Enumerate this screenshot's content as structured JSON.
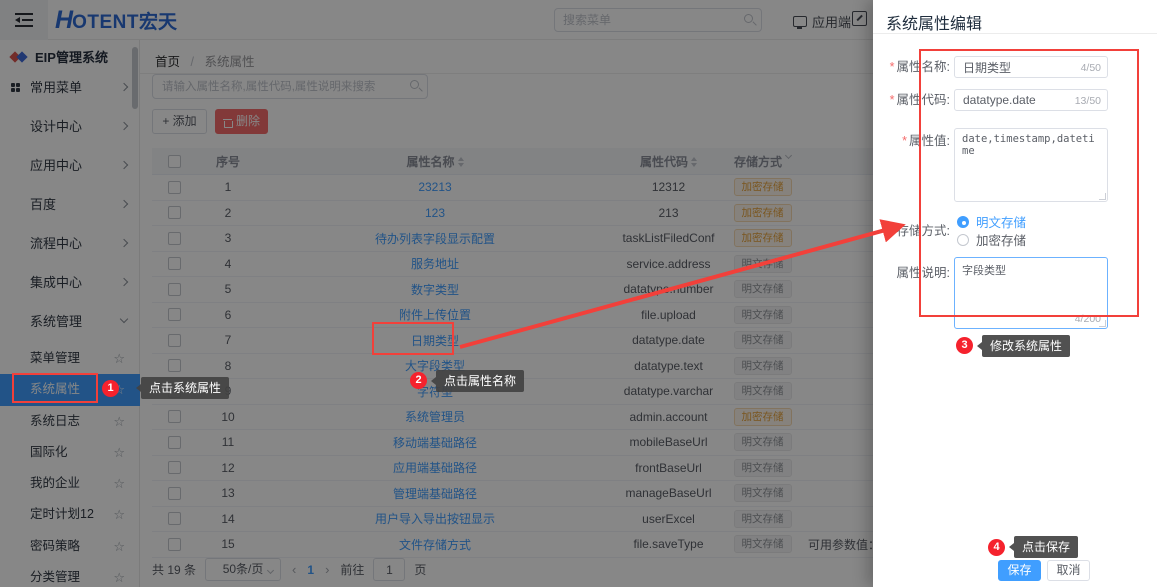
{
  "topbar": {
    "logo_h": "H",
    "logo_rest": "OTENT",
    "logo_cn": "宏天",
    "search_placeholder": "搜索菜单",
    "app_entry": "应用端"
  },
  "sidebar": {
    "title": "EIP管理系统",
    "menu": [
      {
        "label": "常用菜单",
        "chevron": "right",
        "icon": "grid"
      },
      {
        "label": "设计中心",
        "chevron": "right"
      },
      {
        "label": "应用中心",
        "chevron": "right"
      },
      {
        "label": "百度",
        "chevron": "right"
      },
      {
        "label": "流程中心",
        "chevron": "right"
      },
      {
        "label": "集成中心",
        "chevron": "right"
      },
      {
        "label": "系统管理",
        "chevron": "down"
      }
    ],
    "submenu": [
      {
        "label": "菜单管理"
      },
      {
        "label": "系统属性",
        "selected": true
      },
      {
        "label": "系统日志"
      },
      {
        "label": "国际化"
      },
      {
        "label": "我的企业"
      },
      {
        "label": "定时计划12"
      },
      {
        "label": "密码策略"
      },
      {
        "label": "分类管理"
      }
    ],
    "star": "☆"
  },
  "breadcrumb": {
    "home": "首页",
    "separator": "/",
    "current": "系统属性"
  },
  "toolbar": {
    "search_placeholder": "请输入属性名称,属性代码,属性说明来搜索",
    "add_label": "+ 添加",
    "delete_label": "删除"
  },
  "table": {
    "headers": {
      "index": "序号",
      "name": "属性名称",
      "code": "属性代码",
      "storage": "存储方式"
    },
    "storage_labels": {
      "enc": "加密存储",
      "plain": "明文存储"
    },
    "rows": [
      {
        "n": "1",
        "name": "23213",
        "code": "12312",
        "storage": "enc"
      },
      {
        "n": "2",
        "name": "123",
        "code": "213",
        "storage": "enc"
      },
      {
        "n": "3",
        "name": "待办列表字段显示配置",
        "code": "taskListFiledConf",
        "storage": "enc"
      },
      {
        "n": "4",
        "name": "服务地址",
        "code": "service.address",
        "storage": "plain"
      },
      {
        "n": "5",
        "name": "数字类型",
        "code": "datatype.number",
        "storage": "plain"
      },
      {
        "n": "6",
        "name": "附件上传位置",
        "code": "file.upload",
        "storage": "plain"
      },
      {
        "n": "7",
        "name": "日期类型",
        "code": "datatype.date",
        "storage": "plain"
      },
      {
        "n": "8",
        "name": "大字段类型",
        "code": "datatype.text",
        "storage": "plain"
      },
      {
        "n": "9",
        "name": "字符型",
        "code": "datatype.varchar",
        "storage": "plain"
      },
      {
        "n": "10",
        "name": "系统管理员",
        "code": "admin.account",
        "storage": "enc"
      },
      {
        "n": "11",
        "name": "移动端基础路径",
        "code": "mobileBaseUrl",
        "storage": "plain"
      },
      {
        "n": "12",
        "name": "应用端基础路径",
        "code": "frontBaseUrl",
        "storage": "plain"
      },
      {
        "n": "13",
        "name": "管理端基础路径",
        "code": "manageBaseUrl",
        "storage": "plain"
      },
      {
        "n": "14",
        "name": "用户导入导出按钮显示",
        "code": "userExcel",
        "storage": "plain"
      },
      {
        "n": "15",
        "name": "文件存储方式",
        "code": "file.saveType",
        "storage": "plain",
        "desc": "可用参数值：dat"
      }
    ]
  },
  "pagination": {
    "total": "共 19 条",
    "page_size": "50条/页",
    "prev": "‹",
    "page": "1",
    "next": "›",
    "goto_label": "前往",
    "goto_value": "1",
    "unit": "页"
  },
  "drawer": {
    "title": "系统属性编辑",
    "fields": {
      "name": {
        "label": "属性名称:",
        "value": "日期类型",
        "counter": "4/50"
      },
      "code": {
        "label": "属性代码:",
        "value": "datatype.date",
        "counter": "13/50"
      },
      "value": {
        "label": "属性值:",
        "value": "date,timestamp,datetime"
      },
      "storage": {
        "label": "存储方式:",
        "options": [
          {
            "label": "明文存储",
            "checked": true
          },
          {
            "label": "加密存储",
            "checked": false
          }
        ]
      },
      "desc": {
        "label": "属性说明:",
        "value": "字段类型",
        "counter": "4/200"
      }
    },
    "save_label": "保存",
    "cancel_label": "取消"
  },
  "annotations": {
    "steps": [
      {
        "num": "1",
        "label": "点击系统属性"
      },
      {
        "num": "2",
        "label": "点击属性名称"
      },
      {
        "num": "3",
        "label": "修改系统属性"
      },
      {
        "num": "4",
        "label": "点击保存"
      }
    ]
  },
  "colors": {
    "accent": "#409eff",
    "danger": "#f56c6c",
    "annotation_red": "#f2403a",
    "badge_encrypted": "#e6a23c",
    "badge_plain": "#909399"
  }
}
